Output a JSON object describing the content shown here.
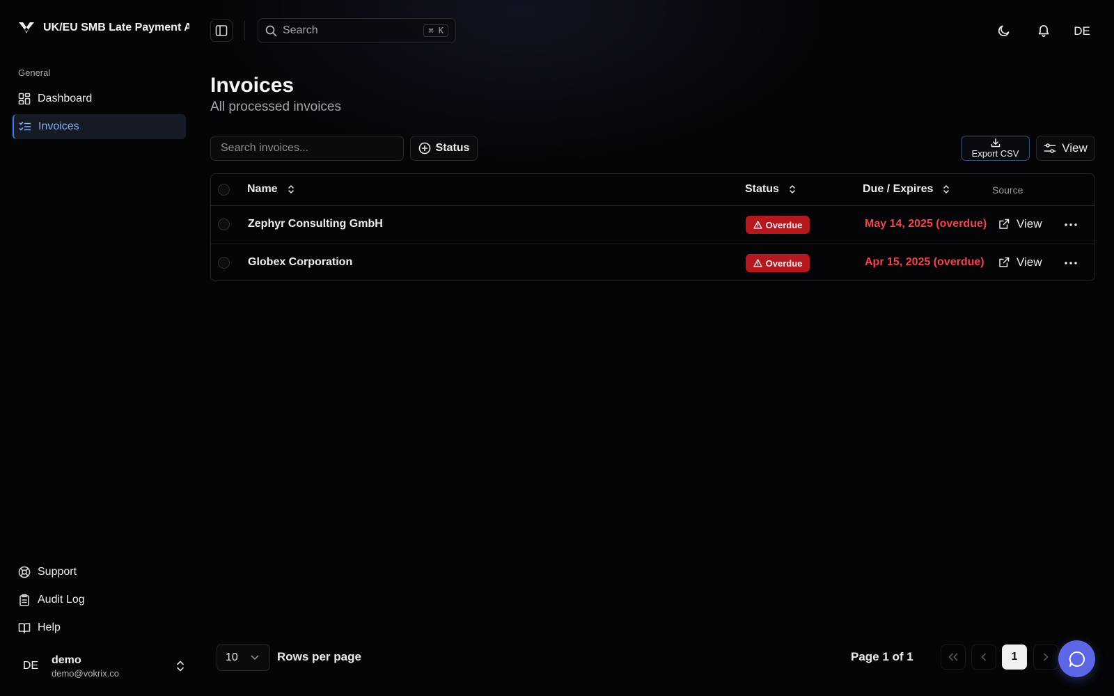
{
  "app": {
    "title": "UK/EU SMB Late Payment A",
    "logo_icon": "crest-logo-icon"
  },
  "sidebar": {
    "section_label": "General",
    "items": [
      {
        "label": "Dashboard",
        "icon": "dashboard-grid-icon",
        "active": false
      },
      {
        "label": "Invoices",
        "icon": "list-checks-icon",
        "active": true
      }
    ],
    "bottom_items": [
      {
        "label": "Support",
        "icon": "lifebuoy-icon"
      },
      {
        "label": "Audit Log",
        "icon": "clipboard-list-icon"
      },
      {
        "label": "Help",
        "icon": "book-open-icon"
      }
    ],
    "user": {
      "initials": "DE",
      "name": "demo",
      "email": "demo@vokrix.co"
    }
  },
  "topbar": {
    "search_placeholder": "Search",
    "search_shortcut": "⌘ K",
    "avatar_initials": "DE"
  },
  "page": {
    "title": "Invoices",
    "subtitle": "All processed invoices"
  },
  "toolbar": {
    "filter_placeholder": "Search invoices...",
    "status_label": "Status",
    "export_label": "Export CSV",
    "view_label": "View"
  },
  "table": {
    "columns": {
      "name": "Name",
      "status": "Status",
      "due": "Due / Expires",
      "source": "Source"
    },
    "rows": [
      {
        "name": "Zephyr Consulting GmbH",
        "status": "Overdue",
        "due": "May 14, 2025 (overdue)",
        "source_action": "View"
      },
      {
        "name": "Globex Corporation",
        "status": "Overdue",
        "due": "Apr 15, 2025 (overdue)",
        "source_action": "View"
      }
    ]
  },
  "pagination": {
    "rows_per_page_value": "10",
    "rows_per_page_label": "Rows per page",
    "page_info": "Page 1 of 1",
    "current_page": "1"
  },
  "colors": {
    "background": "#050507",
    "accent": "#3b82f6",
    "overdue_badge": "#b4191f",
    "overdue_text": "#f0454b",
    "chat_button": "#5d67e6"
  }
}
